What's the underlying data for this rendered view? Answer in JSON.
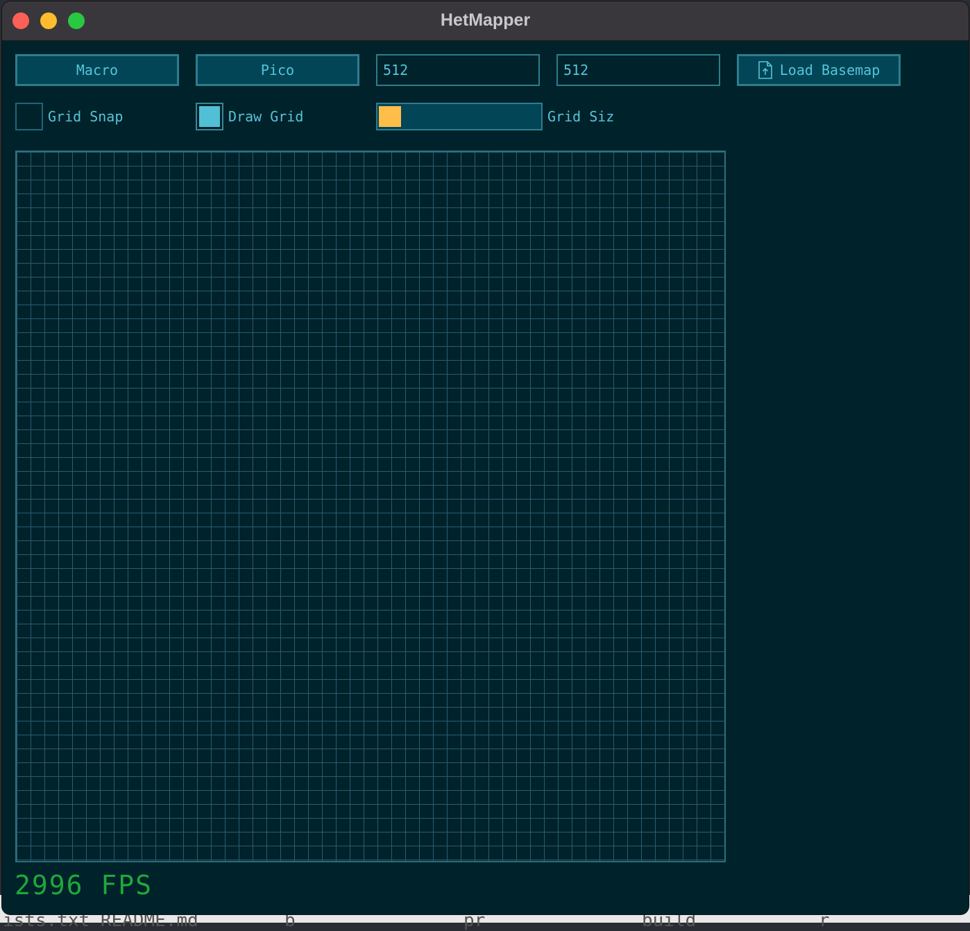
{
  "window": {
    "title": "HetMapper"
  },
  "toolbar": {
    "macro_label": "Macro",
    "pico_label": "Pico",
    "width_value": "512",
    "height_value": "512",
    "load_basemap_label": "Load Basemap"
  },
  "options": {
    "grid_snap_label": "Grid Snap",
    "grid_snap_checked": false,
    "draw_grid_label": "Draw Grid",
    "draw_grid_checked": true,
    "grid_size_label": "Grid Siz",
    "grid_size_fraction": 0.14
  },
  "status": {
    "fps_text": "2996 FPS"
  },
  "background_terminal": {
    "fragments": [
      "ists.txt README.md",
      "b",
      "pr",
      "build",
      "r"
    ]
  },
  "colors": {
    "window_bg": "#00222b",
    "button_bg": "#024556",
    "accent": "#56c4d8",
    "slider_fill": "#ffbd4a",
    "fps": "#1fa83a"
  }
}
